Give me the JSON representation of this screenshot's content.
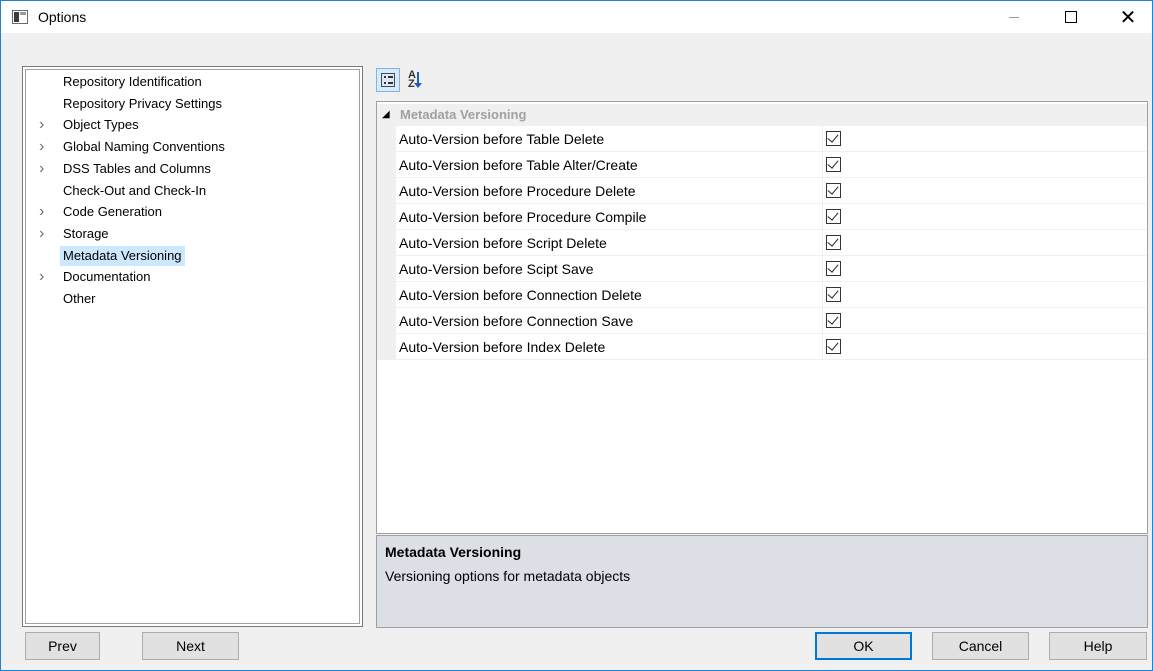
{
  "window": {
    "title": "Options"
  },
  "tree": {
    "items": [
      {
        "label": "Repository Identification",
        "expandable": false,
        "selected": false
      },
      {
        "label": "Repository Privacy Settings",
        "expandable": false,
        "selected": false
      },
      {
        "label": "Object Types",
        "expandable": true,
        "selected": false
      },
      {
        "label": "Global Naming Conventions",
        "expandable": true,
        "selected": false
      },
      {
        "label": "DSS Tables and Columns",
        "expandable": true,
        "selected": false
      },
      {
        "label": "Check-Out and Check-In",
        "expandable": false,
        "selected": false
      },
      {
        "label": "Code Generation",
        "expandable": true,
        "selected": false
      },
      {
        "label": "Storage",
        "expandable": true,
        "selected": false
      },
      {
        "label": "Metadata Versioning",
        "expandable": false,
        "selected": true
      },
      {
        "label": "Documentation",
        "expandable": true,
        "selected": false
      },
      {
        "label": "Other",
        "expandable": false,
        "selected": false
      }
    ]
  },
  "toolbar": {
    "categorized": "categorized-icon",
    "alphabetical": "sort-az-icon"
  },
  "grid": {
    "category": "Metadata Versioning",
    "properties": [
      {
        "name": "Auto-Version before Table Delete",
        "checked": true
      },
      {
        "name": "Auto-Version before Table Alter/Create",
        "checked": true
      },
      {
        "name": "Auto-Version before Procedure Delete",
        "checked": true
      },
      {
        "name": "Auto-Version before Procedure Compile",
        "checked": true
      },
      {
        "name": "Auto-Version before Script Delete",
        "checked": true
      },
      {
        "name": "Auto-Version before Scipt Save",
        "checked": true
      },
      {
        "name": "Auto-Version before Connection Delete",
        "checked": true
      },
      {
        "name": "Auto-Version before Connection Save",
        "checked": true
      },
      {
        "name": "Auto-Version before Index Delete",
        "checked": true
      }
    ]
  },
  "description": {
    "title": "Metadata Versioning",
    "text": "Versioning options for metadata objects"
  },
  "buttons": {
    "prev": "Prev",
    "next": "Next",
    "ok": "OK",
    "cancel": "Cancel",
    "help": "Help"
  },
  "colors": {
    "accent": "#0078d7",
    "selection": "#cce8ff",
    "description_bg": "#dcdfe6"
  }
}
